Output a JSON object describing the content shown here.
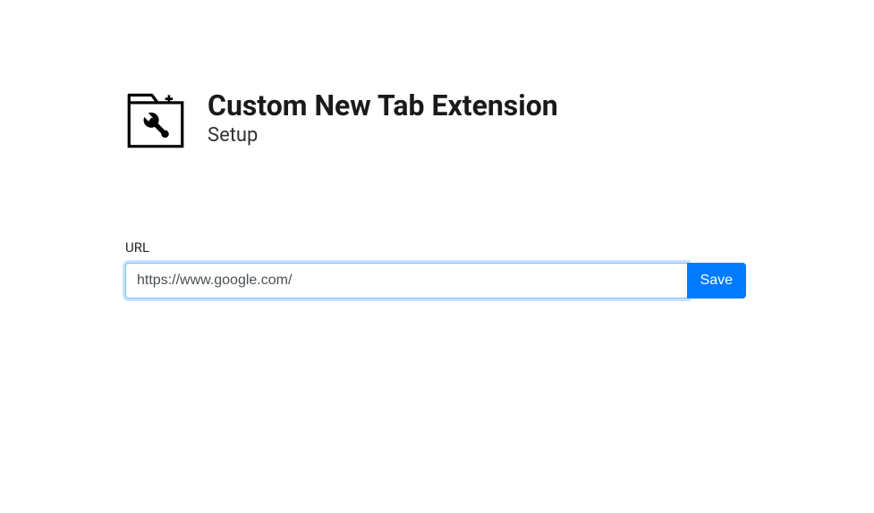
{
  "header": {
    "title": "Custom New Tab Extension",
    "subtitle": "Setup"
  },
  "form": {
    "url_label": "URL",
    "url_value": "https://www.google.com/",
    "save_label": "Save"
  }
}
